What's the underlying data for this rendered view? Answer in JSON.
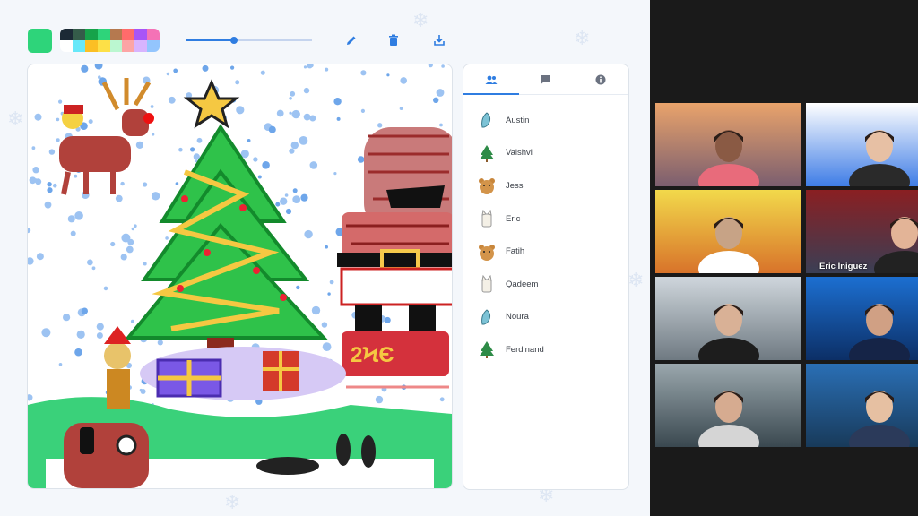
{
  "toolbar": {
    "current_color": "#2ed47a",
    "palette": [
      "#1c2a36",
      "#355c4a",
      "#16a34a",
      "#2ed47a",
      "#b5794f",
      "#ff6b6b",
      "#a855f7",
      "#f472b6",
      "#ffffff",
      "#67e8f9",
      "#fbbf24",
      "#fde047",
      "#bbf7d0",
      "#fca5a5",
      "#d8b4fe",
      "#93c5fd"
    ],
    "brush_size": 0.38,
    "accent": "#2f7de1",
    "tools": [
      "pencil-icon",
      "trash-icon",
      "download-icon"
    ]
  },
  "side_panel": {
    "tabs": [
      "people-icon",
      "chat-icon",
      "info-icon"
    ],
    "active_tab": 0,
    "players": [
      {
        "name": "Austin",
        "avatar": "dolphin-icon"
      },
      {
        "name": "Vaishvi",
        "avatar": "tree-icon"
      },
      {
        "name": "Jess",
        "avatar": "bear-icon"
      },
      {
        "name": "Eric",
        "avatar": "cat-icon"
      },
      {
        "name": "Fatih",
        "avatar": "bear-icon"
      },
      {
        "name": "Qadeem",
        "avatar": "cat-icon"
      },
      {
        "name": "Noura",
        "avatar": "dolphin-icon"
      },
      {
        "name": "Ferdinand",
        "avatar": "tree-icon"
      }
    ]
  },
  "video_call": {
    "participants": [
      {
        "label": ""
      },
      {
        "label": ""
      },
      {
        "label": ""
      },
      {
        "label": "Eric Iniguez"
      },
      {
        "label": ""
      },
      {
        "label": ""
      },
      {
        "label": ""
      },
      {
        "label": ""
      }
    ]
  }
}
